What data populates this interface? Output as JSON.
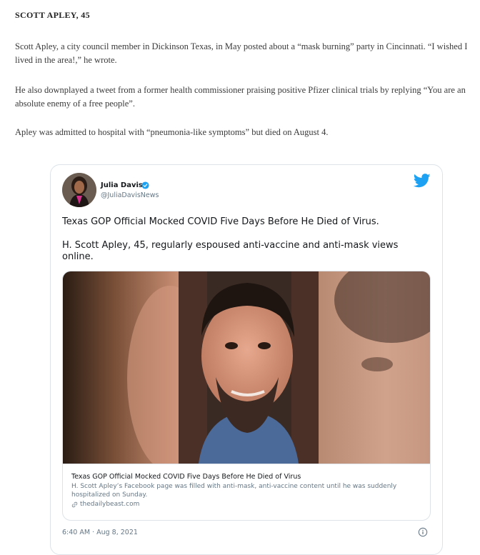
{
  "article": {
    "heading": "SCOTT APLEY, 45",
    "paragraphs": [
      "Scott Apley, a city council member in Dickinson Texas, in May posted about a “mask burning” party in Cincinnati. “I wished I lived in the area!,” he wrote.",
      "He also downplayed a tweet from a former health commissioner praising positive Pfizer clinical trials by replying “You are an absolute enemy of a free people”.",
      "Apley was admitted to hospital with “pneumonia-like symptoms” but died on August 4."
    ]
  },
  "tweet": {
    "author_name": "Julia Davis",
    "author_handle": "@JuliaDavisNews",
    "verified_icon": "verified-badge-icon",
    "platform_icon": "twitter-bird-icon",
    "text_lines": [
      "Texas GOP Official Mocked COVID Five Days Before He Died of Virus.",
      "H. Scott Apley, 45, regularly espoused anti-vaccine and anti-mask views online."
    ],
    "card": {
      "title": "Texas GOP Official Mocked COVID Five Days Before He Died of Virus",
      "description": "H. Scott Apley’s Facebook page was filled with anti-mask, anti-vaccine content until he was suddenly hospitalized on Sunday.",
      "domain": "thedailybeast.com",
      "domain_icon": "link-icon"
    },
    "timestamp": "6:40 AM · Aug 8, 2021",
    "info_icon": "info-icon",
    "colors": {
      "accent": "#1da1f2",
      "handle": "#657786",
      "border": "#dde3e8"
    }
  }
}
